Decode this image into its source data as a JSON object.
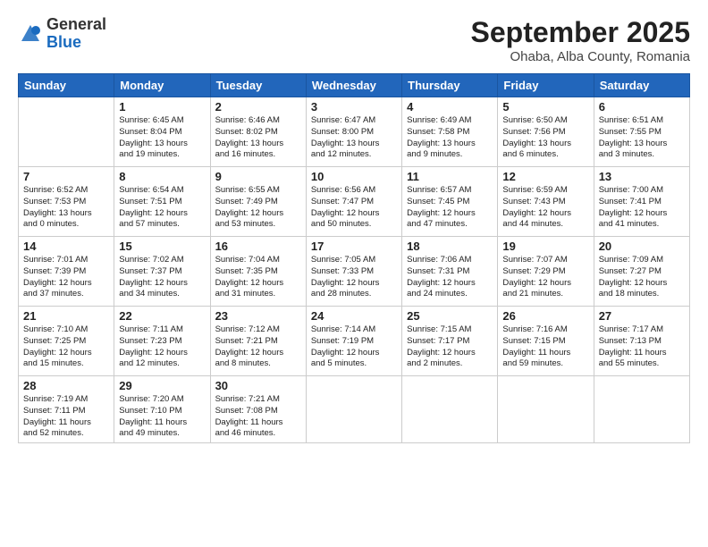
{
  "header": {
    "logo_general": "General",
    "logo_blue": "Blue",
    "month_title": "September 2025",
    "location": "Ohaba, Alba County, Romania"
  },
  "days_of_week": [
    "Sunday",
    "Monday",
    "Tuesday",
    "Wednesday",
    "Thursday",
    "Friday",
    "Saturday"
  ],
  "weeks": [
    [
      {
        "day": "",
        "info": ""
      },
      {
        "day": "1",
        "info": "Sunrise: 6:45 AM\nSunset: 8:04 PM\nDaylight: 13 hours\nand 19 minutes."
      },
      {
        "day": "2",
        "info": "Sunrise: 6:46 AM\nSunset: 8:02 PM\nDaylight: 13 hours\nand 16 minutes."
      },
      {
        "day": "3",
        "info": "Sunrise: 6:47 AM\nSunset: 8:00 PM\nDaylight: 13 hours\nand 12 minutes."
      },
      {
        "day": "4",
        "info": "Sunrise: 6:49 AM\nSunset: 7:58 PM\nDaylight: 13 hours\nand 9 minutes."
      },
      {
        "day": "5",
        "info": "Sunrise: 6:50 AM\nSunset: 7:56 PM\nDaylight: 13 hours\nand 6 minutes."
      },
      {
        "day": "6",
        "info": "Sunrise: 6:51 AM\nSunset: 7:55 PM\nDaylight: 13 hours\nand 3 minutes."
      }
    ],
    [
      {
        "day": "7",
        "info": "Sunrise: 6:52 AM\nSunset: 7:53 PM\nDaylight: 13 hours\nand 0 minutes."
      },
      {
        "day": "8",
        "info": "Sunrise: 6:54 AM\nSunset: 7:51 PM\nDaylight: 12 hours\nand 57 minutes."
      },
      {
        "day": "9",
        "info": "Sunrise: 6:55 AM\nSunset: 7:49 PM\nDaylight: 12 hours\nand 53 minutes."
      },
      {
        "day": "10",
        "info": "Sunrise: 6:56 AM\nSunset: 7:47 PM\nDaylight: 12 hours\nand 50 minutes."
      },
      {
        "day": "11",
        "info": "Sunrise: 6:57 AM\nSunset: 7:45 PM\nDaylight: 12 hours\nand 47 minutes."
      },
      {
        "day": "12",
        "info": "Sunrise: 6:59 AM\nSunset: 7:43 PM\nDaylight: 12 hours\nand 44 minutes."
      },
      {
        "day": "13",
        "info": "Sunrise: 7:00 AM\nSunset: 7:41 PM\nDaylight: 12 hours\nand 41 minutes."
      }
    ],
    [
      {
        "day": "14",
        "info": "Sunrise: 7:01 AM\nSunset: 7:39 PM\nDaylight: 12 hours\nand 37 minutes."
      },
      {
        "day": "15",
        "info": "Sunrise: 7:02 AM\nSunset: 7:37 PM\nDaylight: 12 hours\nand 34 minutes."
      },
      {
        "day": "16",
        "info": "Sunrise: 7:04 AM\nSunset: 7:35 PM\nDaylight: 12 hours\nand 31 minutes."
      },
      {
        "day": "17",
        "info": "Sunrise: 7:05 AM\nSunset: 7:33 PM\nDaylight: 12 hours\nand 28 minutes."
      },
      {
        "day": "18",
        "info": "Sunrise: 7:06 AM\nSunset: 7:31 PM\nDaylight: 12 hours\nand 24 minutes."
      },
      {
        "day": "19",
        "info": "Sunrise: 7:07 AM\nSunset: 7:29 PM\nDaylight: 12 hours\nand 21 minutes."
      },
      {
        "day": "20",
        "info": "Sunrise: 7:09 AM\nSunset: 7:27 PM\nDaylight: 12 hours\nand 18 minutes."
      }
    ],
    [
      {
        "day": "21",
        "info": "Sunrise: 7:10 AM\nSunset: 7:25 PM\nDaylight: 12 hours\nand 15 minutes."
      },
      {
        "day": "22",
        "info": "Sunrise: 7:11 AM\nSunset: 7:23 PM\nDaylight: 12 hours\nand 12 minutes."
      },
      {
        "day": "23",
        "info": "Sunrise: 7:12 AM\nSunset: 7:21 PM\nDaylight: 12 hours\nand 8 minutes."
      },
      {
        "day": "24",
        "info": "Sunrise: 7:14 AM\nSunset: 7:19 PM\nDaylight: 12 hours\nand 5 minutes."
      },
      {
        "day": "25",
        "info": "Sunrise: 7:15 AM\nSunset: 7:17 PM\nDaylight: 12 hours\nand 2 minutes."
      },
      {
        "day": "26",
        "info": "Sunrise: 7:16 AM\nSunset: 7:15 PM\nDaylight: 11 hours\nand 59 minutes."
      },
      {
        "day": "27",
        "info": "Sunrise: 7:17 AM\nSunset: 7:13 PM\nDaylight: 11 hours\nand 55 minutes."
      }
    ],
    [
      {
        "day": "28",
        "info": "Sunrise: 7:19 AM\nSunset: 7:11 PM\nDaylight: 11 hours\nand 52 minutes."
      },
      {
        "day": "29",
        "info": "Sunrise: 7:20 AM\nSunset: 7:10 PM\nDaylight: 11 hours\nand 49 minutes."
      },
      {
        "day": "30",
        "info": "Sunrise: 7:21 AM\nSunset: 7:08 PM\nDaylight: 11 hours\nand 46 minutes."
      },
      {
        "day": "",
        "info": ""
      },
      {
        "day": "",
        "info": ""
      },
      {
        "day": "",
        "info": ""
      },
      {
        "day": "",
        "info": ""
      }
    ]
  ]
}
